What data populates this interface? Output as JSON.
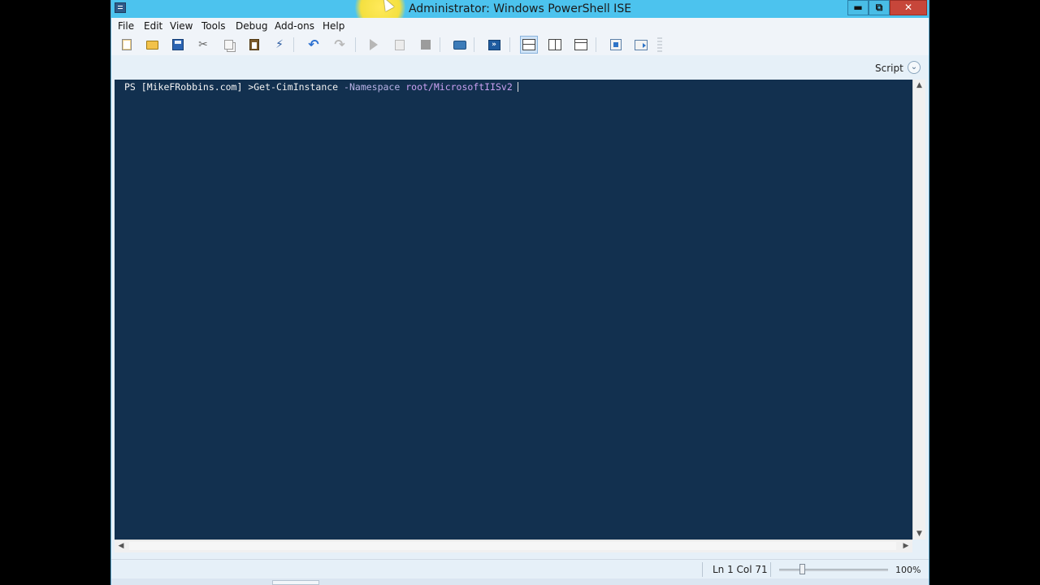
{
  "window": {
    "title": "Administrator: Windows PowerShell ISE",
    "controls": {
      "minimize": "▬",
      "maximize": "⧉",
      "close": "✕"
    }
  },
  "menubar": {
    "items": [
      "File",
      "Edit",
      "View",
      "Tools",
      "Debug",
      "Add-ons",
      "Help"
    ]
  },
  "toolbar": {
    "icons": [
      "new-icon",
      "open-icon",
      "save-icon",
      "cut-icon",
      "copy-icon",
      "paste-icon",
      "clear-console-icon",
      "undo-icon",
      "redo-icon",
      "run-script-icon",
      "run-selection-icon",
      "stop-icon",
      "new-remote-tab-icon",
      "start-powershell-icon",
      "layout-script-top-icon",
      "layout-script-right-icon",
      "layout-script-maximized-icon",
      "show-command-window-icon",
      "show-command-addon-icon"
    ]
  },
  "scriptbar": {
    "label": "Script",
    "chevron": "⌄"
  },
  "console": {
    "prompt": "PS [MikeFRobbins.com] >",
    "command": "Get-CimInstance",
    "parameter": "-Namespace",
    "argument": "root/MicrosoftIISv2",
    "colors": {
      "background": "#12304f",
      "text": "#eeedf0",
      "parameter": "#b8b2e6",
      "argument": "#c9a0f0"
    }
  },
  "scrollbars": {
    "up": "▲",
    "down": "▼",
    "left": "◀",
    "right": "▶"
  },
  "status": {
    "position": "Ln 1  Col 71",
    "zoom": "100%",
    "zoom_level_percent": 100
  },
  "colors": {
    "titlebar": "#4cc3ee",
    "close_button": "#c7463a"
  }
}
